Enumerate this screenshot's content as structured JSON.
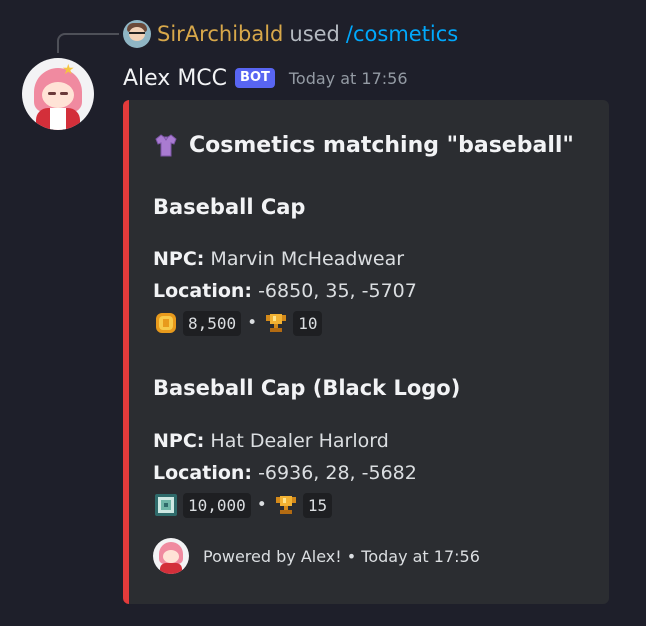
{
  "command": {
    "user": "SirArchibald",
    "used": "used",
    "slash": "/cosmetics"
  },
  "message": {
    "author": "Alex MCC",
    "badge": "BOT",
    "timestamp": "Today at 17:56"
  },
  "embed": {
    "accent_color": "#e33b3b",
    "title": "Cosmetics matching \"baseball\"",
    "title_icon": "tshirt-icon",
    "items": [
      {
        "name": "Baseball Cap",
        "npc_label": "NPC:",
        "npc": "Marvin McHeadwear",
        "location_label": "Location:",
        "location": "-6850, 35, -5707",
        "currency_icon": "gold-coin-icon",
        "price": "8,500",
        "separator": "•",
        "trophy_icon": "trophy-icon",
        "trophies": "10"
      },
      {
        "name": "Baseball Cap (Black Logo)",
        "npc_label": "NPC:",
        "npc": "Hat Dealer Harlord",
        "location_label": "Location:",
        "location": "-6936, 28, -5682",
        "currency_icon": "gem-icon",
        "price": "10,000",
        "separator": "•",
        "trophy_icon": "trophy-icon",
        "trophies": "15"
      }
    ],
    "footer": "Powered by Alex! • Today at 17:56"
  }
}
